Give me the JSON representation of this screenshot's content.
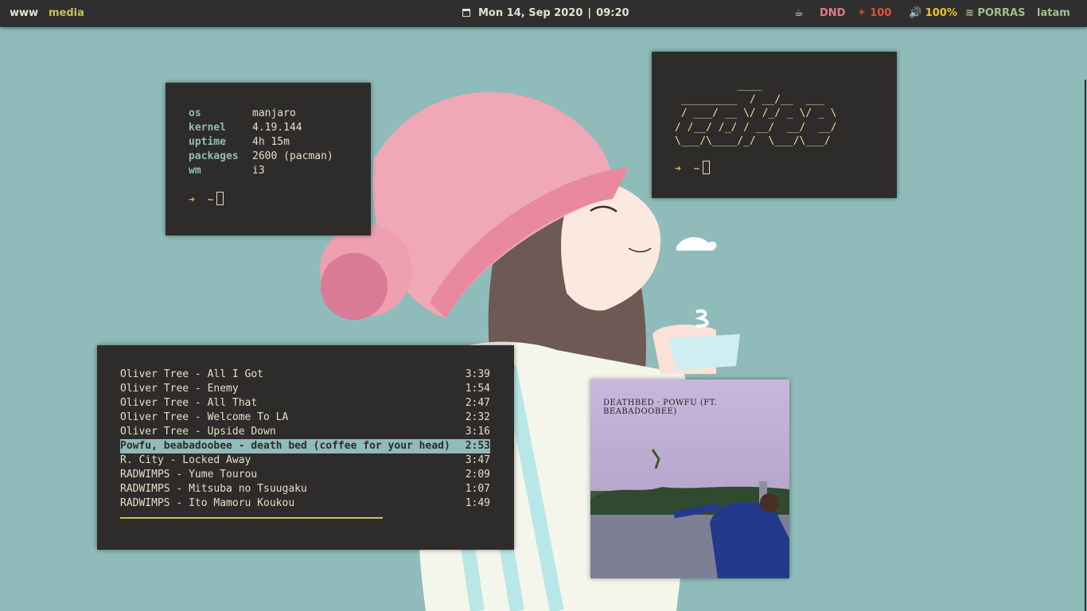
{
  "bar": {
    "workspaces": [
      "www",
      "media"
    ],
    "active_workspace": "media",
    "calendar_icon": "calendar-icon",
    "date": "Mon 14, Sep 2020",
    "separator": "|",
    "time": "09:20",
    "cup_icon": "coffee-cup-icon",
    "dnd": "DND",
    "brightness_icon": "sun-icon",
    "brightness": "100",
    "volume_icon": "speaker-icon",
    "volume": "100%",
    "wifi_icon": "wifi-icon",
    "network": "PORRAS",
    "keyboard_layout": "latam",
    "colors": {
      "bar_bg": "#2f2f2f",
      "accent_yellow": "#c8c35a",
      "dnd": "#e07a8a",
      "brightness": "#e5533d",
      "volume": "#f1c232",
      "network": "#a3be8c"
    }
  },
  "fetch_terminal": {
    "rows": [
      {
        "key": "os",
        "value": "manjaro"
      },
      {
        "key": "kernel",
        "value": "4.19.144"
      },
      {
        "key": "uptime",
        "value": "4h 15m"
      },
      {
        "key": "packages",
        "value": "2600 (pacman)"
      },
      {
        "key": "wm",
        "value": "i3"
      }
    ],
    "prompt_arrow": "➜",
    "prompt_dir": "~"
  },
  "ascii_terminal": {
    "art": "          ____\n _________  / __/__  ___\n / ___/ __ \\/ /_/ _ \\/ _ \\\n/ /__/ /_/ / __/  __/  __/\n\\___/\\____/_/  \\___/\\___/",
    "prompt_arrow": "➜",
    "prompt_dir": "~"
  },
  "player": {
    "tracks": [
      {
        "title": "Oliver Tree - All I Got",
        "duration": "3:39",
        "playing": false
      },
      {
        "title": "Oliver Tree - Enemy",
        "duration": "1:54",
        "playing": false
      },
      {
        "title": "Oliver Tree - All That",
        "duration": "2:47",
        "playing": false
      },
      {
        "title": "Oliver Tree - Welcome To LA",
        "duration": "2:32",
        "playing": false
      },
      {
        "title": "Oliver Tree - Upside Down",
        "duration": "3:16",
        "playing": false
      },
      {
        "title": "Powfu, beabadoobee - death bed (coffee for your head)",
        "duration": "2:53",
        "playing": true
      },
      {
        "title": "R. City - Locked Away",
        "duration": "3:47",
        "playing": false
      },
      {
        "title": "RADWIMPS - Yume Tourou",
        "duration": "2:09",
        "playing": false
      },
      {
        "title": "RADWIMPS - Mitsuba no Tsuugaku",
        "duration": "1:07",
        "playing": false
      },
      {
        "title": "RADWIMPS - Ito Mamoru Koukou",
        "duration": "1:49",
        "playing": false
      }
    ],
    "progress": 0.71
  },
  "album_art": {
    "caption": "DEATHBED · POWFU (FT. BEABADOOBEE)"
  }
}
